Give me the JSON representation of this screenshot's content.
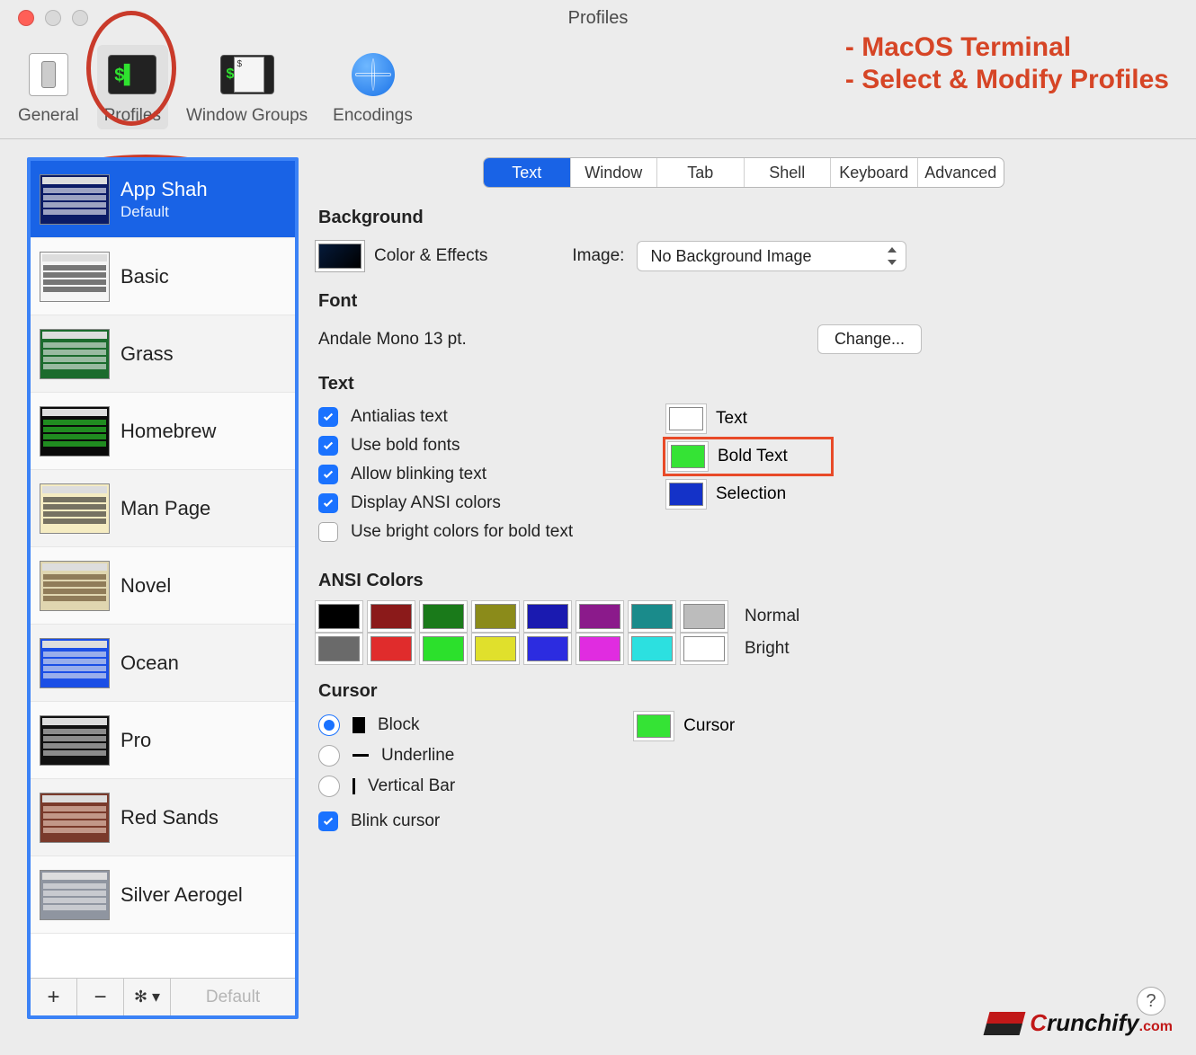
{
  "window": {
    "title": "Profiles"
  },
  "annotation": {
    "line1": "- MacOS Terminal",
    "line2": "- Select & Modify Profiles"
  },
  "toolbar": {
    "general": "General",
    "profiles": "Profiles",
    "window_groups": "Window Groups",
    "encodings": "Encodings"
  },
  "sidebar": {
    "profiles": [
      {
        "name": "App Shah",
        "sub": "Default",
        "selected": true,
        "bg": "#0b1b66",
        "fg": "#ffffff"
      },
      {
        "name": "Basic",
        "bg": "#f4f4f4",
        "fg": "#222"
      },
      {
        "name": "Grass",
        "bg": "#1b6b2d",
        "fg": "#eee"
      },
      {
        "name": "Homebrew",
        "bg": "#0a0a0a",
        "fg": "#2fe22f"
      },
      {
        "name": "Man Page",
        "bg": "#f5ecc2",
        "fg": "#222"
      },
      {
        "name": "Novel",
        "bg": "#e0d6b0",
        "fg": "#5a4020"
      },
      {
        "name": "Ocean",
        "bg": "#1b4fe6",
        "fg": "#eee"
      },
      {
        "name": "Pro",
        "bg": "#111",
        "fg": "#ddd"
      },
      {
        "name": "Red Sands",
        "bg": "#7a3a2b",
        "fg": "#f2d6c6"
      },
      {
        "name": "Silver Aerogel",
        "bg": "#8f95a0",
        "fg": "#eee"
      }
    ],
    "footer": {
      "plus": "+",
      "minus": "−",
      "default_btn": "Default"
    }
  },
  "tabs": [
    "Text",
    "Window",
    "Tab",
    "Shell",
    "Keyboard",
    "Advanced"
  ],
  "tabs_selected": 0,
  "background": {
    "heading": "Background",
    "color_effects": "Color & Effects",
    "image_label": "Image:",
    "image_value": "No Background Image"
  },
  "font": {
    "heading": "Font",
    "value": "Andale Mono 13 pt.",
    "change_btn": "Change..."
  },
  "text": {
    "heading": "Text",
    "antialias": "Antialias text",
    "bold_fonts": "Use bold fonts",
    "blinking": "Allow blinking text",
    "ansi": "Display ANSI colors",
    "bright_bold": "Use bright colors for bold text",
    "text_label": "Text",
    "bold_text_label": "Bold Text",
    "selection_label": "Selection",
    "text_color": "#ffffff",
    "bold_text_color": "#35e335",
    "selection_color": "#1432c8"
  },
  "ansi": {
    "heading": "ANSI Colors",
    "normal_label": "Normal",
    "bright_label": "Bright",
    "normal": [
      "#000000",
      "#8b1a1a",
      "#1a7a1a",
      "#8b8b1a",
      "#1a1ab0",
      "#8b1a8b",
      "#1a8b8b",
      "#bcbcbc"
    ],
    "bright": [
      "#6a6a6a",
      "#e02c2c",
      "#2ce02c",
      "#e0e02c",
      "#2c2ce0",
      "#e02ce0",
      "#2ce0e0",
      "#ffffff"
    ]
  },
  "cursor": {
    "heading": "Cursor",
    "block": "Block",
    "underline": "Underline",
    "vertical": "Vertical Bar",
    "blink": "Blink cursor",
    "cursor_label": "Cursor",
    "cursor_color": "#35e335"
  },
  "branding": {
    "name1": "C",
    "name2": "runchify",
    "suffix": ".com"
  }
}
